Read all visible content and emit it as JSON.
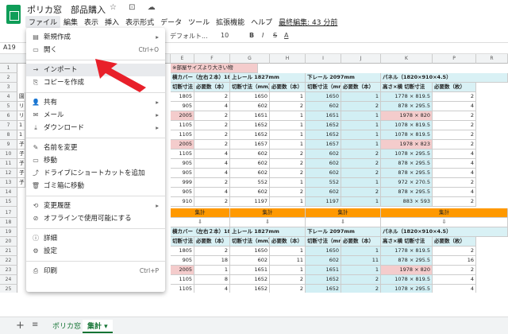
{
  "app": {
    "title": "ポリカ窓　部品購入",
    "title_icons": "☆ ⊡ ☁",
    "last_edit": "最終編集: 43 分前"
  },
  "menubar": [
    "ファイル",
    "編集",
    "表示",
    "挿入",
    "表示形式",
    "データ",
    "ツール",
    "拡張機能",
    "ヘルプ"
  ],
  "toolbar": {
    "font": "デフォルト...",
    "size": "10",
    "bold": "B",
    "italic": "I",
    "strike": "S",
    "textcolor": "A"
  },
  "namebox": "A19",
  "file_menu": {
    "items": [
      {
        "icon": "▤",
        "label": "新規作成",
        "shortcut": "▸"
      },
      {
        "icon": "▭",
        "label": "開く",
        "shortcut": "Ctrl+O"
      },
      {
        "icon": "→",
        "label": "インポート",
        "shortcut": ""
      },
      {
        "icon": "⎘",
        "label": "コピーを作成",
        "shortcut": ""
      },
      {
        "icon": "👤",
        "label": "共有",
        "shortcut": "▸"
      },
      {
        "icon": "✉",
        "label": "メール",
        "shortcut": "▸"
      },
      {
        "icon": "⤓",
        "label": "ダウンロード",
        "shortcut": "▸"
      },
      {
        "icon": "✎",
        "label": "名前を変更",
        "shortcut": ""
      },
      {
        "icon": "▭",
        "label": "移動",
        "shortcut": ""
      },
      {
        "icon": "⤴",
        "label": "ドライブにショートカットを追加",
        "shortcut": ""
      },
      {
        "icon": "🗑",
        "label": "ゴミ箱に移動",
        "shortcut": ""
      },
      {
        "icon": "⟲",
        "label": "変更履歴",
        "shortcut": "▸"
      },
      {
        "icon": "⊘",
        "label": "オフラインで使用可能にする",
        "shortcut": ""
      },
      {
        "icon": "ⓘ",
        "label": "詳細",
        "shortcut": ""
      },
      {
        "icon": "⚙",
        "label": "設定",
        "shortcut": ""
      },
      {
        "icon": "⎙",
        "label": "印刷",
        "shortcut": "Ctrl+P"
      }
    ]
  },
  "sheet": {
    "columns": [
      "E",
      "F",
      "G",
      "H",
      "I",
      "J",
      "K",
      "P",
      "R"
    ],
    "note": "※部屋サイズより大きい物",
    "block_headers": [
      "横カバー（左右２本）1845mm",
      "上レール 1827mm",
      "下レール 2097mm",
      "パネル（1820×910×4.5）"
    ],
    "sub_headers": [
      "切断寸法（mm）",
      "必要数（本）",
      "切断寸法（mm）",
      "必要数（本）",
      "切断寸法（mm）",
      "必要数（本）",
      "高さ×横 切断寸法",
      "必要数（枚）"
    ],
    "rows_top": [
      [
        "1805",
        "2",
        "1650",
        "1",
        "1650",
        "1",
        "1778 × 819.5",
        "2"
      ],
      [
        "905",
        "4",
        "602",
        "2",
        "602",
        "2",
        "878 × 295.5",
        "4"
      ],
      [
        "2005",
        "2",
        "1651",
        "1",
        "1651",
        "1",
        "1978 × 820",
        "2"
      ],
      [
        "1105",
        "2",
        "1652",
        "1",
        "1652",
        "1",
        "1078 × 819.5",
        "2"
      ],
      [
        "1105",
        "2",
        "1652",
        "1",
        "1652",
        "1",
        "1078 × 819.5",
        "2"
      ],
      [
        "2005",
        "2",
        "1657",
        "1",
        "1657",
        "1",
        "1978 × 823",
        "2"
      ],
      [
        "1105",
        "4",
        "602",
        "2",
        "602",
        "2",
        "1078 × 295.5",
        "4"
      ],
      [
        "905",
        "4",
        "602",
        "2",
        "602",
        "2",
        "878 × 295.5",
        "4"
      ],
      [
        "905",
        "4",
        "602",
        "2",
        "602",
        "2",
        "878 × 295.5",
        "4"
      ],
      [
        "999",
        "2",
        "552",
        "1",
        "552",
        "1",
        "972 × 270.5",
        "2"
      ],
      [
        "905",
        "4",
        "602",
        "2",
        "602",
        "2",
        "878 × 295.5",
        "4"
      ],
      [
        "910",
        "2",
        "1197",
        "1",
        "1197",
        "1",
        "883 × 593",
        "2"
      ]
    ],
    "summary_label": "集計",
    "summary_arrow": "⇩",
    "rows_bottom": [
      [
        "1805",
        "2",
        "1650",
        "1",
        "1650",
        "1",
        "1778 × 819.5",
        "2"
      ],
      [
        "905",
        "18",
        "602",
        "11",
        "602",
        "11",
        "878 × 295.5",
        "16"
      ],
      [
        "2005",
        "1",
        "1651",
        "1",
        "1651",
        "1",
        "1978 × 820",
        "2"
      ],
      [
        "1105",
        "8",
        "1652",
        "2",
        "1652",
        "2",
        "1078 × 819.5",
        "4"
      ],
      [
        "1105",
        "4",
        "1652",
        "2",
        "1652",
        "2",
        "1078 × 295.5",
        "4"
      ],
      [
        "2005",
        "2",
        "1657",
        "1",
        "1657",
        "1",
        "1978 × 823",
        "2"
      ],
      [
        "910",
        "2",
        "552",
        "1",
        "552",
        "1",
        "972 × 270.5",
        "2"
      ],
      [
        "",
        "",
        "1197",
        "1",
        "1197",
        "1",
        "883 × 593",
        "2"
      ]
    ],
    "row_numbers_top": [
      "1",
      "2",
      "3",
      "4",
      "5",
      "6",
      "7",
      "8",
      "9",
      "10",
      "11",
      "12",
      "13",
      "14",
      "15",
      "16"
    ],
    "row_numbers_bottom": [
      "17",
      "18",
      "19",
      "20",
      "21",
      "22",
      "23",
      "24",
      "25",
      "26",
      "27"
    ],
    "left_hint": [
      "園",
      "リ",
      "リ",
      "1",
      "1",
      "子",
      "子",
      "子",
      "子",
      "子"
    ]
  },
  "bottom": {
    "add": "+",
    "list": "≡",
    "tab1": "ポリカ窓",
    "tab2": "集計 ▾"
  }
}
